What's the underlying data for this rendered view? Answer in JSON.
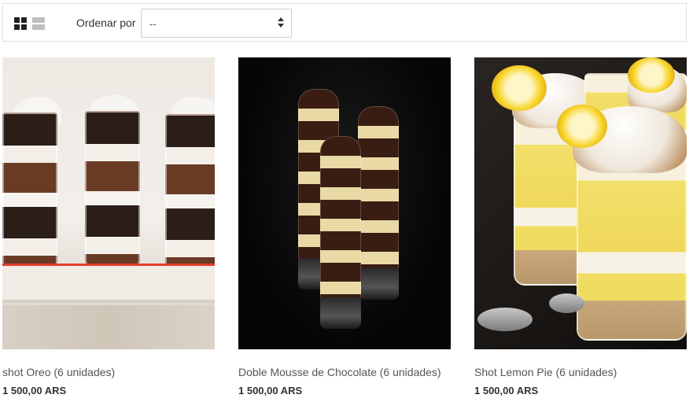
{
  "toolbar": {
    "sort_label": "Ordenar por",
    "sort_value": "--",
    "views": [
      "grid-view-icon",
      "list-view-icon"
    ]
  },
  "products": [
    {
      "name": "shot Oreo (6 unidades)",
      "price": "1 500,00 ARS"
    },
    {
      "name": "Doble Mousse de Chocolate (6 unidades)",
      "price": "1 500,00 ARS"
    },
    {
      "name": "Shot Lemon Pie (6 unidades)",
      "price": "1 500,00 ARS"
    }
  ],
  "colors": {
    "price": "#333333",
    "border": "#e1e1e1"
  }
}
